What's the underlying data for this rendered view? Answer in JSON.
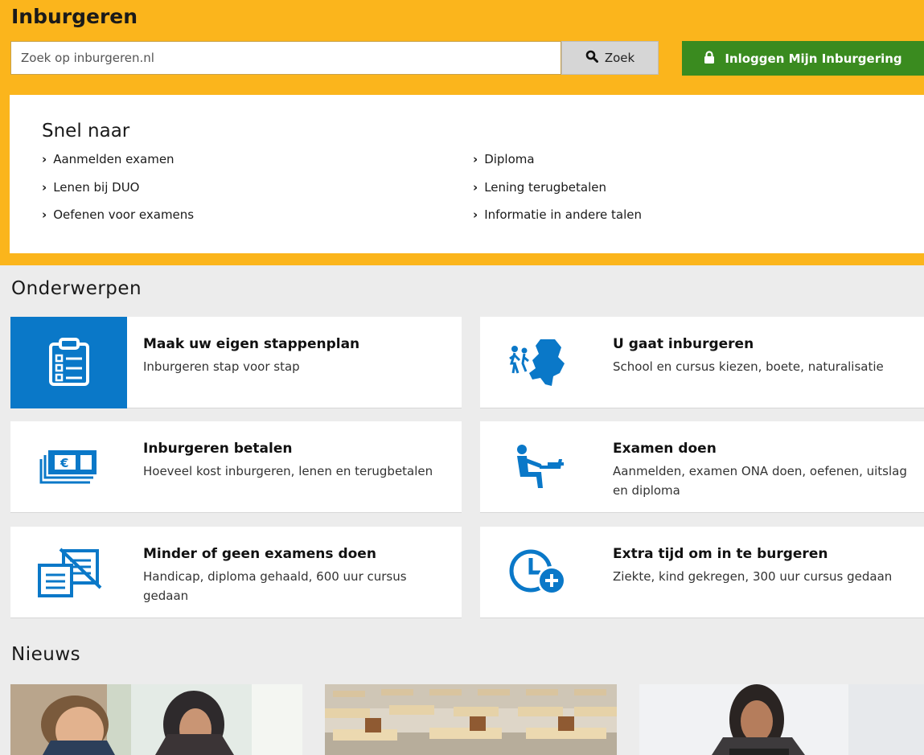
{
  "header": {
    "site_title": "Inburgeren",
    "search_placeholder": "Zoek op inburgeren.nl",
    "search_button": "Zoek",
    "login_button": "Inloggen Mijn Inburgering"
  },
  "quick_links": {
    "title": "Snel naar",
    "left": [
      "Aanmelden examen",
      "Lenen bij DUO",
      "Oefenen voor examens"
    ],
    "right": [
      "Diploma",
      "Lening terugbetalen",
      "Informatie in andere talen"
    ]
  },
  "topics": {
    "title": "Onderwerpen",
    "cards": [
      {
        "title": "Maak uw eigen stappenplan",
        "desc": "Inburgeren stap voor stap",
        "icon": "checklist-icon"
      },
      {
        "title": "U gaat inburgeren",
        "desc": "School en cursus kiezen, boete, naturalisatie",
        "icon": "netherlands-map-icon"
      },
      {
        "title": "Inburgeren betalen",
        "desc": "Hoeveel kost inburgeren, lenen en terugbetalen",
        "icon": "euro-banknotes-icon"
      },
      {
        "title": "Examen doen",
        "desc": "Aanmelden, examen ONA doen, oefenen, uitslag en diploma",
        "icon": "person-at-computer-icon"
      },
      {
        "title": "Minder of geen examens doen",
        "desc": "Handicap, diploma gehaald, 600 uur cursus gedaan",
        "icon": "crossed-document-icon"
      },
      {
        "title": "Extra tijd om in te burgeren",
        "desc": "Ziekte, kind gekregen, 300 uur cursus gedaan",
        "icon": "clock-plus-icon"
      }
    ]
  },
  "news": {
    "title": "Nieuws"
  },
  "colors": {
    "accent_yellow": "#fbb51c",
    "login_green": "#3a8b1f",
    "icon_blue": "#0a78c8"
  }
}
